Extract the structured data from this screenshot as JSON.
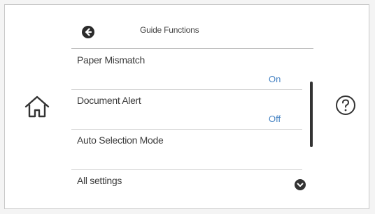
{
  "header": {
    "title": "Guide Functions"
  },
  "settings": {
    "items": [
      {
        "label": "Paper Mismatch",
        "value": "On"
      },
      {
        "label": "Document Alert",
        "value": "Off"
      },
      {
        "label": "Auto Selection Mode"
      },
      {
        "label": "All settings"
      }
    ]
  },
  "icons": {
    "back": "back-arrow-icon",
    "home": "home-icon",
    "help": "help-icon",
    "scroll_down": "chevron-down-icon"
  },
  "colors": {
    "value_text": "#4a86c5",
    "icon_dark": "#2b2b2b"
  }
}
